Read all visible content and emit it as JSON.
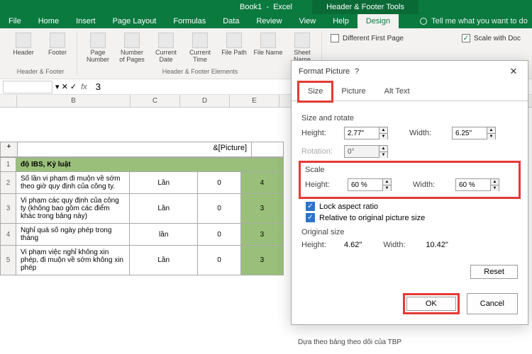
{
  "title": {
    "doc": "Book1",
    "app": "Excel",
    "contextual": "Header & Footer Tools"
  },
  "tabs": {
    "file": "File",
    "home": "Home",
    "insert": "Insert",
    "page": "Page Layout",
    "formulas": "Formulas",
    "data": "Data",
    "review": "Review",
    "view": "View",
    "help": "Help",
    "design": "Design",
    "tellme": "Tell me what you want to do"
  },
  "ribbon": {
    "hf": {
      "header": "Header",
      "footer": "Footer",
      "group": "Header & Footer"
    },
    "elem": {
      "page": "Page Number",
      "pages": "Number of Pages",
      "date": "Current Date",
      "time": "Current Time",
      "path": "File Path",
      "name": "File Name",
      "sheet": "Sheet Name",
      "group": "Header & Footer Elements"
    },
    "opts": {
      "diff_first": "Different First Page",
      "scale": "Scale with Doc"
    }
  },
  "formula": {
    "fx": "fx",
    "val": "3"
  },
  "cols": [
    "B",
    "C",
    "D",
    "E"
  ],
  "picture_code": "&[Picture]",
  "htitle": "độ IBS, Kỷ luật",
  "rows": [
    {
      "n": "2",
      "t": "Số lần vi phạm đi muộn về sớm theo giờ quy định của công ty.",
      "u": "Lần",
      "a": "0",
      "b": "4"
    },
    {
      "n": "3",
      "t": "Vi phạm các quy định của công ty (không bao gồm các điểm khác trong bảng này)",
      "u": "Lần",
      "a": "0",
      "b": "3"
    },
    {
      "n": "4",
      "t": "Nghỉ quá số ngày phép trong tháng",
      "u": "lần",
      "a": "0",
      "b": "3"
    },
    {
      "n": "5",
      "t": "Vi phạm việc nghỉ không xin phép, đi muộn về sớm không xin phép",
      "u": "Lần",
      "a": "0",
      "b": "3"
    }
  ],
  "dlg": {
    "title": "Format Picture",
    "tabs": {
      "size": "Size",
      "picture": "Picture",
      "alt": "Alt Text"
    },
    "size_rotate": "Size and rotate",
    "height_l": "Height:",
    "width_l": "Width:",
    "rotation_l": "Rotation:",
    "height_v": "2.77\"",
    "width_v": "6.25\"",
    "rotation_v": "0°",
    "scale": "Scale",
    "sheight_l": "Height:",
    "swidth_l": "Width:",
    "sheight_v": "60 %",
    "swidth_v": "60 %",
    "lock": "Lock aspect ratio",
    "relative": "Relative to original picture size",
    "orig": "Original size",
    "oheight_v": "4.62\"",
    "owidth_v": "10.42\"",
    "reset": "Reset",
    "ok": "OK",
    "cancel": "Cancel"
  },
  "below": "Dựa theo bảng theo dõi của TBP"
}
